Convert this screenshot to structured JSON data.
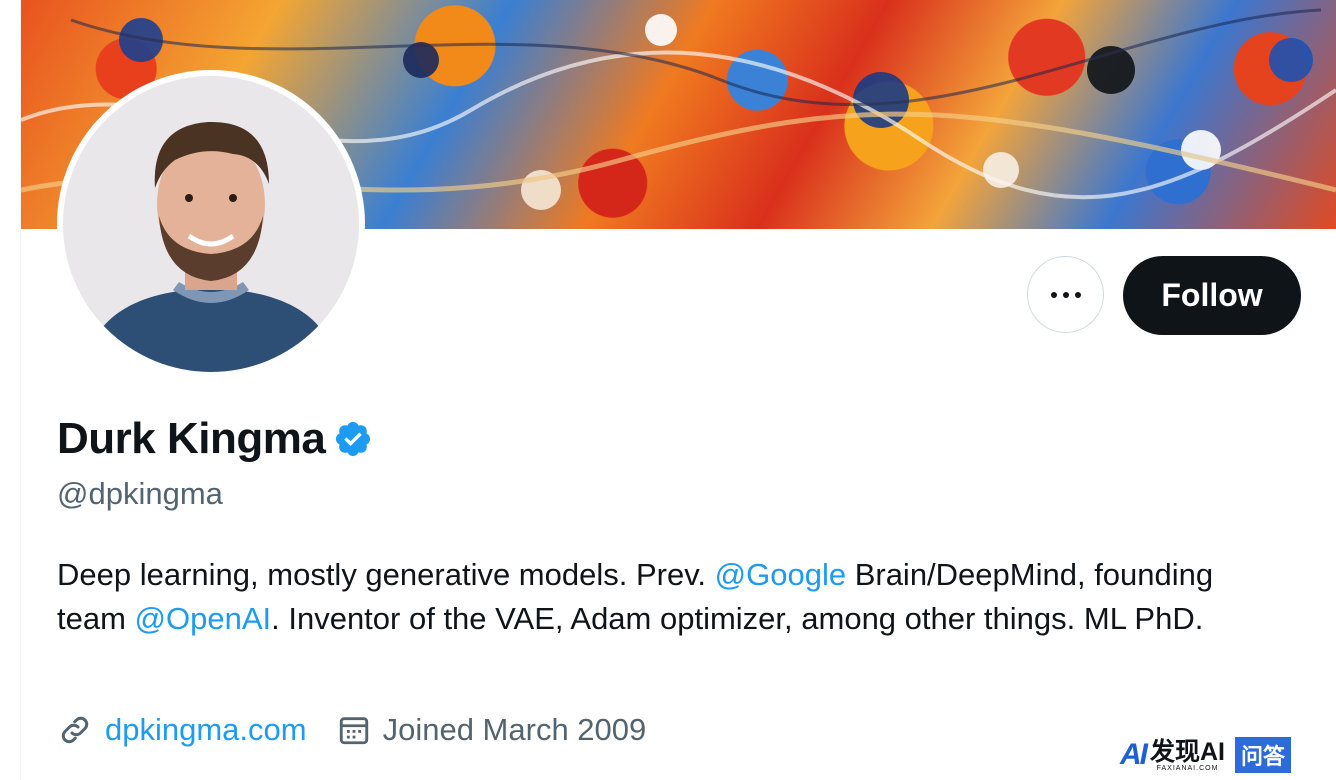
{
  "profile": {
    "display_name": "Durk Kingma",
    "handle": "@dpkingma",
    "verified": true,
    "bio": {
      "p1": "Deep learning, mostly generative models. Prev. ",
      "mention1": "@Google",
      "p2": " Brain/DeepMind, founding team ",
      "mention2": "@OpenAI",
      "p3": ". Inventor of the VAE, Adam optimizer, among other things. ML PhD."
    },
    "website": "dpkingma.com",
    "joined": "Joined March 2009"
  },
  "actions": {
    "follow_label": "Follow"
  },
  "icons": {
    "more": "more-horizontal-icon",
    "verified": "verified-badge-icon",
    "link": "link-icon",
    "calendar": "calendar-icon"
  },
  "colors": {
    "accent": "#1d9bf0",
    "text": "#0f1419",
    "secondary_text": "#536471",
    "follow_bg": "#0f1419",
    "border": "#cfd9de"
  },
  "watermark": {
    "logo": "AI",
    "text": "发现AI",
    "sub": "FAXIANAI.COM",
    "badge": "问答"
  }
}
